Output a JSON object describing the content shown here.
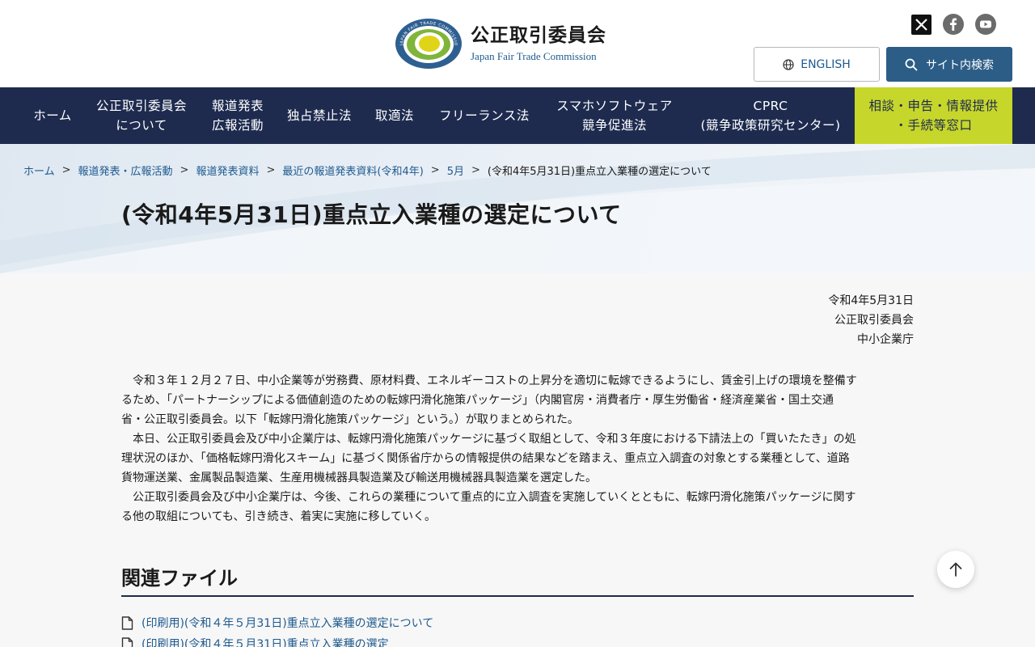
{
  "header": {
    "org_name_jp": "公正取引委員会",
    "org_name_en": "Japan Fair Trade Commission",
    "emblem_ring_text": "JAPAN FAIR TRADE COMMISSION",
    "english_label": "ENGLISH",
    "search_label": "サイト内検索",
    "sns": [
      "x-icon",
      "facebook-icon",
      "youtube-icon"
    ]
  },
  "nav": {
    "items": [
      {
        "id": "home",
        "lines": [
          "ホーム"
        ]
      },
      {
        "id": "about",
        "lines": [
          "公正取引委員会",
          "について"
        ]
      },
      {
        "id": "press",
        "lines": [
          "報道発表",
          "広報活動"
        ]
      },
      {
        "id": "antimonopoly",
        "lines": [
          "独占禁止法"
        ]
      },
      {
        "id": "torihiki",
        "lines": [
          "取適法"
        ]
      },
      {
        "id": "freelance",
        "lines": [
          "フリーランス法"
        ]
      },
      {
        "id": "smartphone",
        "lines": [
          "スマホソフトウェア",
          "競争促進法"
        ]
      },
      {
        "id": "cprc",
        "lines": [
          "CPRC",
          "(競争政策研究センター)"
        ]
      },
      {
        "id": "consult",
        "lines": [
          "相談・申告・情報提供",
          "・手続等窓口"
        ]
      }
    ]
  },
  "breadcrumb": {
    "items": [
      "ホーム",
      "報道発表・広報活動",
      "報道発表資料",
      "最近の報道発表資料(令和4年)",
      "5月"
    ],
    "current": "(令和4年5月31日)重点立入業種の選定について"
  },
  "page": {
    "title": "(令和4年5月31日)重点立入業種の選定について",
    "date": "令和4年5月31日",
    "issuer1": "公正取引委員会",
    "issuer2": "中小企業庁",
    "paragraph1_line1": "令和３年１２月２７日、中小企業等が労務費、原材料費、エネルギーコストの上昇分を適切に転嫁できるようにし、賃金引上げの環境を整備す",
    "paragraph1_line2": "るため、「パートナーシップによる価値創造のための転嫁円滑化施策パッケージ」（内閣官房・消費者庁・厚生労働省・経済産業省・国土交通",
    "paragraph1_line3": "省・公正取引委員会。以下「転嫁円滑化施策パッケージ」という。）が取りまとめられた。",
    "paragraph2_line1": "本日、公正取引委員会及び中小企業庁は、転嫁円滑化施策パッケージに基づく取組として、令和３年度における下請法上の「買いたたき」の処",
    "paragraph2_line2": "理状況のほか、「価格転嫁円滑化スキーム」に基づく関係省庁からの情報提供の結果などを踏まえ、重点立入調査の対象とする業種として、道路",
    "paragraph2_line3": "貨物運送業、金属製品製造業、生産用機械器具製造業及び輸送用機械器具製造業を選定した。",
    "paragraph3_line1": "公正取引委員会及び中小企業庁は、今後、これらの業種について重点的に立入調査を実施していくとともに、転嫁円滑化施策パッケージに関す",
    "paragraph3_line2": "る他の取組についても、引き続き、着実に実施に移していく。"
  },
  "related": {
    "title": "関連ファイル",
    "files": [
      "(印刷用)(令和４年５月31日)重点立入業種の選定について",
      "(印刷用)(令和４年５月31日)重点立入業種の選定"
    ]
  },
  "colors": {
    "nav_bg": "#1e2b4f",
    "consult_bg": "#c6d62b",
    "search_bg": "#2c5d87",
    "link": "#1d5a8e"
  }
}
